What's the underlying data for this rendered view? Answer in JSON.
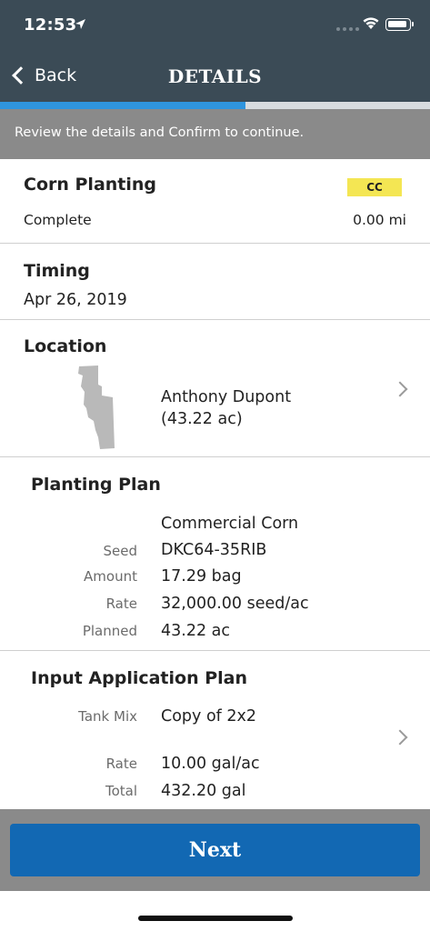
{
  "status_bar": {
    "time": "12:53",
    "location_icon": "location-arrow-icon",
    "signal_icon": "signal-dots-icon",
    "wifi_icon": "wifi-icon",
    "battery_icon": "battery-icon"
  },
  "nav": {
    "back_label": "Back",
    "title": "DETAILS"
  },
  "progress": {
    "fraction": 0.57
  },
  "banner": {
    "text": "Review the details and Confirm to continue."
  },
  "activity": {
    "title": "Corn Planting",
    "badge": "CC",
    "status": "Complete",
    "distance": "0.00 mi"
  },
  "timing": {
    "title": "Timing",
    "date": "Apr 26, 2019"
  },
  "location": {
    "title": "Location",
    "field_name": "Anthony Dupont",
    "area": "(43.22 ac)"
  },
  "planting_plan": {
    "title": "Planting Plan",
    "product": "Commercial Corn",
    "rows": [
      {
        "label": "Seed",
        "value": "DKC64-35RIB"
      },
      {
        "label": "Amount",
        "value": "17.29 bag"
      },
      {
        "label": "Rate",
        "value": "32,000.00 seed/ac"
      },
      {
        "label": "Planned",
        "value": "43.22 ac"
      }
    ]
  },
  "input_plan": {
    "title": "Input Application Plan",
    "rows": [
      {
        "label": "Tank Mix",
        "value": "Copy of 2x2"
      },
      {
        "label": "Rate",
        "value": "10.00 gal/ac"
      },
      {
        "label": "Total",
        "value": "432.20 gal"
      }
    ]
  },
  "footer": {
    "next_label": "Next"
  },
  "colors": {
    "header": "#3b4b56",
    "progress": "#2f95de",
    "badge": "#f4e653",
    "button": "#1268b3",
    "banner": "#8a8a8a"
  }
}
